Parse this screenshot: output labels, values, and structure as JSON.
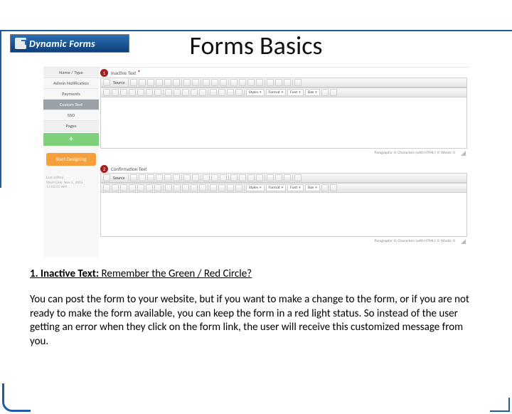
{
  "logo": {
    "brand": "Dynamic Forms"
  },
  "title": "Forms Basics",
  "sidebar": {
    "items": [
      {
        "label": "Name / Type"
      },
      {
        "label": "Admin Notification"
      },
      {
        "label": "Payments"
      },
      {
        "label": "Custom Text"
      },
      {
        "label": "SSO"
      },
      {
        "label": "Pages"
      }
    ],
    "start": "Start Designing",
    "last_edited": "Last edited",
    "meta_line1": "Short Link: Nov 5, 2015",
    "meta_line2": "11:02:07 AM"
  },
  "editor1": {
    "num": "1",
    "title": "Inactive Text",
    "source": "Source",
    "styles": "Styles",
    "format": "Format",
    "font": "Font",
    "size": "Size",
    "status": "Paragraphs: 0, Characters (with HTML): 0, Words: 0"
  },
  "editor2": {
    "num": "2",
    "title": "Confirmation Text",
    "source": "Source",
    "styles": "Styles",
    "format": "Format",
    "font": "Font",
    "size": "Size",
    "status": "Paragraphs: 0, Characters (with HTML): 0, Words: 0"
  },
  "body": {
    "lead": "1. Inactive Text:",
    "lead_tail": " Remember the Green / Red Circle?",
    "para": "You can post the form to your website, but if you want to make a change to the form, or if you are not ready to make the form available, you can keep the form in a red light status.   So instead of the user getting an error when they click on the form link, the user will receive this customized message from you."
  }
}
